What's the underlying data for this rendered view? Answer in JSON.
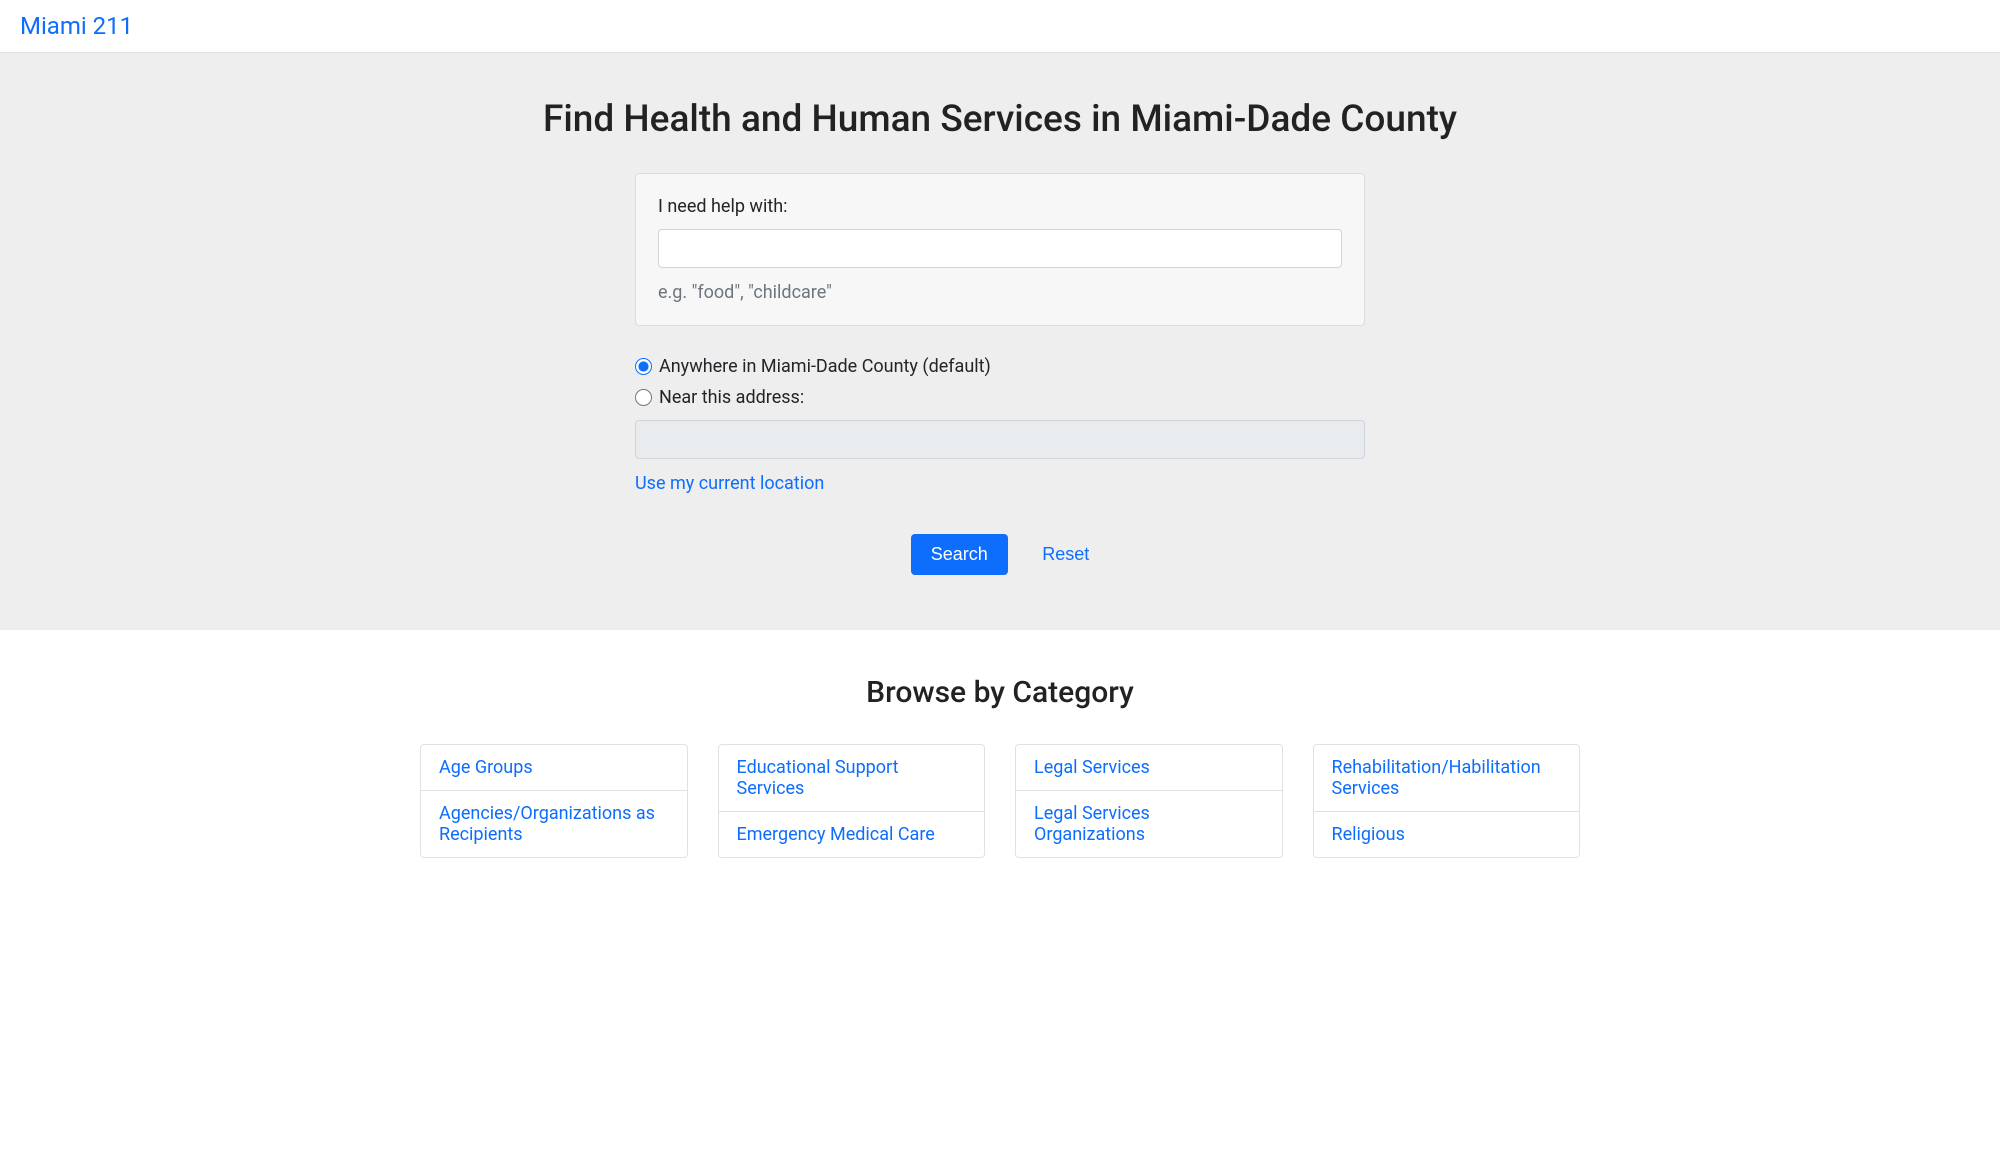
{
  "brand": "Miami 211",
  "hero": {
    "title": "Find Health and Human Services in Miami-Dade County",
    "search_label": "I need help with:",
    "search_value": "",
    "search_help": "e.g. \"food\", \"childcare\"",
    "radio_anywhere": "Anywhere in Miami-Dade County (default)",
    "radio_near": "Near this address:",
    "address_value": "",
    "use_location": "Use my current location",
    "search_button": "Search",
    "reset_button": "Reset"
  },
  "browse": {
    "heading": "Browse by Category",
    "columns": [
      [
        "Age Groups",
        "Agencies/Organizations as Recipients"
      ],
      [
        "Educational Support Services",
        "Emergency Medical Care"
      ],
      [
        "Legal Services",
        "Legal Services Organizations"
      ],
      [
        "Rehabilitation/Habilitation Services",
        "Religious"
      ]
    ]
  }
}
